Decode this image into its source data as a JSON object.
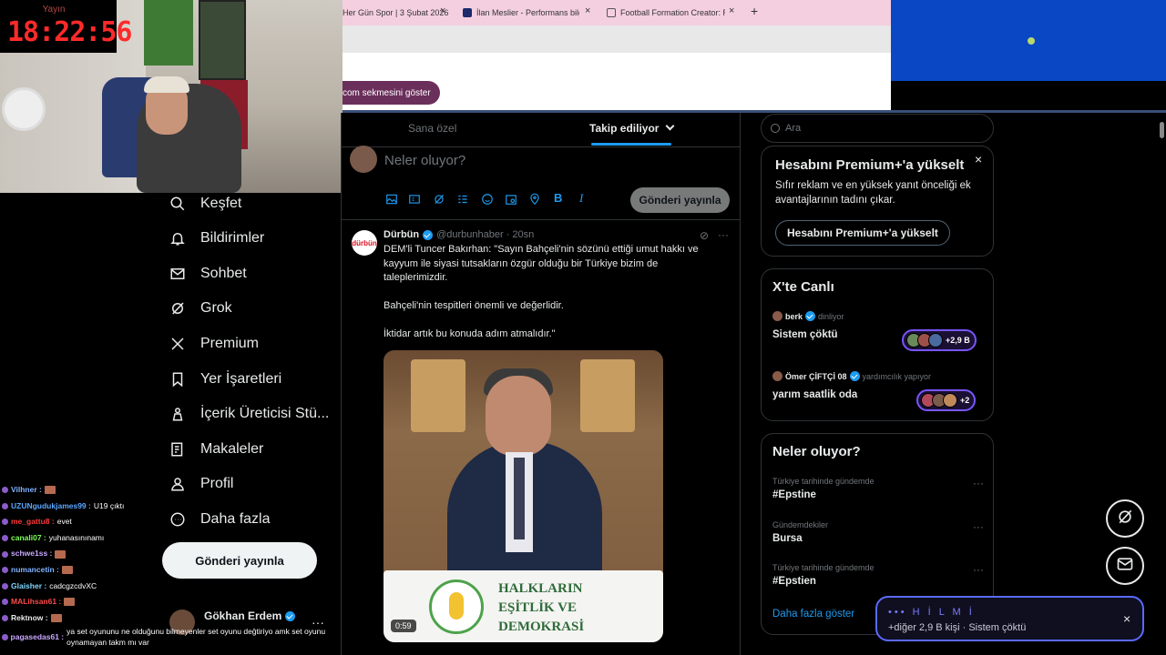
{
  "overlay": {
    "clock_label": "Yayın",
    "clock": "18:22:56"
  },
  "browser": {
    "tabs": [
      {
        "label": "Her Gün Spor | 3 Şubat 2026"
      },
      {
        "label": "İlan Meslier - Performans bilgi"
      },
      {
        "label": "Football Formation Creator: Re"
      }
    ],
    "new_tab": "+",
    "show_tab_label": "com sekmesini göster"
  },
  "sidebar": {
    "items": [
      {
        "label": "Keşfet",
        "icon": "search-icon"
      },
      {
        "label": "Bildirimler",
        "icon": "bell-icon"
      },
      {
        "label": "Sohbet",
        "icon": "mail-icon"
      },
      {
        "label": "Grok",
        "icon": "grok-icon"
      },
      {
        "label": "Premium",
        "icon": "x-logo-icon"
      },
      {
        "label": "Yer İşaretleri",
        "icon": "bookmark-icon"
      },
      {
        "label": "İçerik Üreticisi Stü...",
        "icon": "creator-studio-icon"
      },
      {
        "label": "Makaleler",
        "icon": "articles-icon"
      },
      {
        "label": "Profil",
        "icon": "profile-icon"
      },
      {
        "label": "Daha fazla",
        "icon": "more-circle-icon"
      }
    ],
    "post_button": "Gönderi yayınla",
    "user_name": "Gökhan Erdem",
    "user_more": "···"
  },
  "chat": [
    {
      "user": "Vilhner",
      "text": "",
      "color": "#7fb2ff"
    },
    {
      "user": "UZUNgudukjames99",
      "text": "U19 çıktı",
      "color": "#5aa7ff"
    },
    {
      "user": "me_gattu8",
      "text": "evet",
      "color": "#ff3b3b"
    },
    {
      "user": "canali07",
      "text": "yuhanasınınamı",
      "color": "#7dff5a"
    },
    {
      "user": "schwe1ss",
      "text": "",
      "color": "#c9a8ff"
    },
    {
      "user": "numancetin",
      "text": "",
      "color": "#7fb2ff"
    },
    {
      "user": "Glaisher",
      "text": "cadcgzcdvXC",
      "color": "#7fd6ff"
    },
    {
      "user": "MALihsan61",
      "text": "",
      "color": "#ff4a4a"
    },
    {
      "user": "Rektnow",
      "text": "",
      "color": "#e7e9ea"
    },
    {
      "user": "pagasedas61",
      "text": "ya set oyununu ne olduğunu bilmeyenler set oyunu değtiriyo amk set oyunu oynamayan takm mı var",
      "color": "#c9a8ff"
    }
  ],
  "feed": {
    "tab_for_you": "Sana özel",
    "tab_following": "Takip ediliyor",
    "composer_placeholder": "Neler oluyor?",
    "composer_post": "Gönderi yayınla",
    "tweet": {
      "avatar_text": "dürbün",
      "name": "Dürbün",
      "handle": "@durbunhaber · 20sn",
      "lines": [
        "DEM'li Tuncer Bakırhan: \"Sayın Bahçeli'nin sözünü ettiği umut hakkı ve",
        "kayyum ile siyasi tutsakların özgür olduğu bir Türkiye bizim de",
        "taleplerimizdir.",
        "Bahçeli'nin tespitleri önemli ve değerlidir.",
        "İktidar artık bu konuda adım atmalıdır.\""
      ],
      "video_duration": "0:59",
      "podium_text": "HALKLARIN\nEŞİTLİK VE\nDEMOKRASİ"
    }
  },
  "right": {
    "search_placeholder": "Ara",
    "premium": {
      "title": "Hesabını Premium+'a yükselt",
      "text": "Sıfır reklam ve en yüksek yanıt önceliği ek avantajlarının tadını çıkar.",
      "button": "Hesabını Premium+'a yükselt"
    },
    "live": {
      "title": "X'te Canlı",
      "rows": [
        {
          "user": "berk",
          "activity": "dinliyor",
          "title": "Sistem çöktü",
          "count": "+2,9 B"
        },
        {
          "user": "Ömer ÇİFTÇİ 08",
          "activity": "yardımcılık yapıyor",
          "title": "yarım saatlik oda",
          "count": "+2"
        }
      ]
    },
    "trends": {
      "title": "Neler oluyor?",
      "items": [
        {
          "context": "Türkiye tarihinde gündemde",
          "name": "#Epstine"
        },
        {
          "context": "Gündemdekiler",
          "name": "Bursa"
        },
        {
          "context": "Türkiye tarihinde gündemde",
          "name": "#Epstien"
        }
      ],
      "show_more": "Daha fazla göster"
    }
  },
  "notification": {
    "line1": "••• H İ L M İ",
    "line2": "+diğer 2,9 B kişi · Sistem çöktü"
  }
}
